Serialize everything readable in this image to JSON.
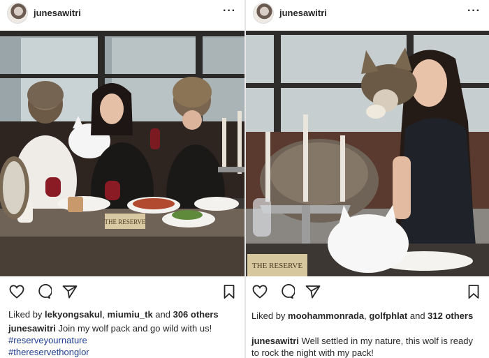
{
  "posts": [
    {
      "username": "junesawitri",
      "more_icon": "···",
      "liked_by_prefix": "Liked by ",
      "liked_user_1": "lekyongsakul",
      "liked_sep": ", ",
      "liked_user_2": "miumiu_tk",
      "liked_and": " and ",
      "liked_count": "306 others",
      "caption_user": "junesawitri",
      "caption_text": " Join my wolf pack and go wild with us!",
      "hashtags": [
        "#reserveyournature",
        "#thereservethonglor"
      ],
      "photo_sign": "THE RESERVE"
    },
    {
      "username": "junesawitri",
      "more_icon": "···",
      "liked_by_prefix": "Liked by ",
      "liked_user_1": "moohammonrada",
      "liked_sep": ", ",
      "liked_user_2": "golfphlat",
      "liked_and": " and ",
      "liked_count": "312 others",
      "caption_user": "junesawitri",
      "caption_text": " Well settled in my nature, this wolf is ready to rock the night with my pack!",
      "photo_sign": "THE RESERVE"
    }
  ],
  "icons": [
    "heart-icon",
    "comment-icon",
    "share-icon",
    "bookmark-icon",
    "more-icon"
  ]
}
